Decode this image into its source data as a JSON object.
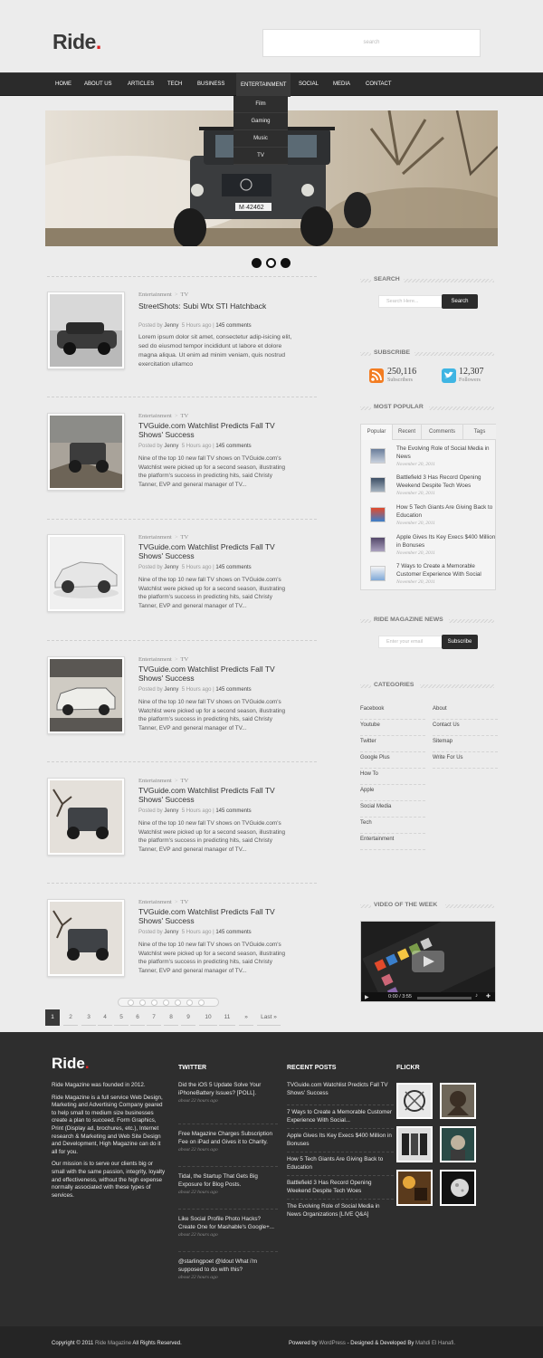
{
  "header": {
    "logo": "Ride",
    "logo_dot": ".",
    "search_placeholder": "search"
  },
  "nav": {
    "items": [
      "HOME",
      "ABOUT US",
      "ARTICLES",
      "TECH",
      "BUSINESS",
      "ENTERTAINMENT",
      "SOCIAL",
      "MEDIA",
      "CONTACT"
    ],
    "dropdown": [
      "Film",
      "Gaming",
      "Music",
      "TV"
    ]
  },
  "slider": {
    "plate": "M·42462"
  },
  "posts": [
    {
      "category": "Entertainment",
      "sub": "TV",
      "title": "StreetShots: Subi Wtx STI Hatchback",
      "posted_by": "Posted by",
      "author": "Jenny",
      "time": "5 Hours ago",
      "comments": "145 comments",
      "excerpt": "Lorem ipsum dolor sit amet, consectetur adip-isicing elit, sed do eiusmod tempor incididunt ut labore et dolore magna aliqua. Ut enim ad minim veniam, quis nostrud exercitation ullamco"
    },
    {
      "category": "Entertainment",
      "sub": "TV",
      "title": "TVGuide.com Watchlist Predicts Fall TV Shows' Success",
      "posted_by": "Posted by",
      "author": "Jenny",
      "time": "5 Hours ago",
      "comments": "145 comments",
      "excerpt": "Nine of the top 10 new fall TV shows on TVGuide.com's Watchlist were picked up for a second season, illustrating the platform's success in predicting hits, said Christy Tanner, EVP and general manager of TV..."
    },
    {
      "category": "Entertainment",
      "sub": "TV",
      "title": "TVGuide.com Watchlist Predicts Fall TV Shows' Success",
      "posted_by": "Posted by",
      "author": "Jenny",
      "time": "5 Hours ago",
      "comments": "145 comments",
      "excerpt": "Nine of the top 10 new fall TV shows on TVGuide.com's Watchlist were picked up for a second season, illustrating the platform's success in predicting hits, said Christy Tanner, EVP and general manager of TV..."
    },
    {
      "category": "Entertainment",
      "sub": "TV",
      "title": "TVGuide.com Watchlist Predicts Fall TV Shows' Success",
      "posted_by": "Posted by",
      "author": "Jenny",
      "time": "5 Hours ago",
      "comments": "145 comments",
      "excerpt": "Nine of the top 10 new fall TV shows on TVGuide.com's Watchlist were picked up for a second season, illustrating the platform's success in predicting hits, said Christy Tanner, EVP and general manager of TV..."
    },
    {
      "category": "Entertainment",
      "sub": "TV",
      "title": "TVGuide.com Watchlist Predicts Fall TV Shows' Success",
      "posted_by": "Posted by",
      "author": "Jenny",
      "time": "5 Hours ago",
      "comments": "145 comments",
      "excerpt": "Nine of the top 10 new fall TV shows on TVGuide.com's Watchlist were picked up for a second season, illustrating the platform's success in predicting hits, said Christy Tanner, EVP and general manager of TV..."
    },
    {
      "category": "Entertainment",
      "sub": "TV",
      "title": "TVGuide.com Watchlist Predicts Fall TV Shows' Success",
      "posted_by": "Posted by",
      "author": "Jenny",
      "time": "5 Hours ago",
      "comments": "145 comments",
      "excerpt": "Nine of the top 10 new fall TV shows on TVGuide.com's Watchlist were picked up for a second season, illustrating the platform's success in predicting hits, said Christy Tanner, EVP and general manager of TV..."
    }
  ],
  "pagination": {
    "pages": [
      "1",
      "2",
      "3",
      "4",
      "5",
      "6",
      "7",
      "8",
      "9",
      "10",
      "11",
      "»",
      "Last »"
    ],
    "current": "1"
  },
  "sidebar": {
    "search": {
      "title": "SEARCH",
      "placeholder": "Search Here...",
      "button": "Search"
    },
    "subscribe": {
      "title": "SUBSCRIBE",
      "rss_count": "250,116",
      "rss_label": "Subscribers",
      "twitter_count": "12,307",
      "twitter_label": "Followers"
    },
    "popular": {
      "title": "MOST POPULAR",
      "tabs": [
        "Popular",
        "Recent",
        "Comments",
        "Tags"
      ],
      "items": [
        {
          "title": "The Evolving Role of Social Media in News",
          "date": "November 20, 2011"
        },
        {
          "title": "Battlefield 3 Has Record Opening Weekend Despite Tech Woes",
          "date": "November 20, 2011"
        },
        {
          "title": "How 5 Tech Giants Are Giving Back to Education",
          "date": "November 20, 2011"
        },
        {
          "title": "Apple Gives Its Key Execs $400 Million in Bonuses",
          "date": "November 20, 2011"
        },
        {
          "title": "7 Ways to Create a Memorable Customer Experience With Social",
          "date": "November 20, 2011"
        }
      ]
    },
    "news": {
      "title": "RIDE MAGAZINE NEWS",
      "placeholder": "Enter your email",
      "button": "Subscribe"
    },
    "categories": {
      "title": "CATEGORIES",
      "left": [
        "Facebook",
        "Youtube",
        "Twitter",
        "Google Plus",
        "How To",
        "Apple",
        "Social Media",
        "Tech",
        "Entertainment"
      ],
      "right": [
        "About",
        "Contact Us",
        "Sitemap",
        "Write For Us"
      ]
    },
    "video": {
      "title": "VIDEO OF THE WEEK",
      "time": "0:00 / 3:55"
    }
  },
  "footer": {
    "logo": "Ride",
    "about": [
      "Ride Magazine was founded in 2012.",
      "Ride Magazine is a full service Web Design, Marketing and Advertising Company geared to help small to medium size businesses create a plan to succeed. Form Graphics, Print (Display ad, brochures, etc.), Internet research & Marketing and Web Site Design and Development, High Magazine can do it all for you.",
      "Our mission is to serve our clients big or small with the same passion, integrity, loyalty and effectiveness, without the high expense normally associated with these types of services."
    ],
    "twitter": {
      "title": "TWITTER",
      "tweets": [
        {
          "text": "Did the iOS 5 Update Solve Your iPhoneBattery Issues? [POLL].",
          "date": "about 22 hours ago"
        },
        {
          "text": "Free Magazine Charges Subscription Fee on iPad and Gives it to Charity.",
          "date": "about 22 hours ago"
        },
        {
          "text": "Tidal, the Startup That Gets Big Exposure for Blog Posts.",
          "date": "about 22 hours ago"
        },
        {
          "text": "Like Social Profile Photo Hacks? Create One for Mashable's Google+...",
          "date": "about 22 hours ago"
        },
        {
          "text": "@starlingpoet @Idout What i'm supposed to do with this?",
          "date": "about 22 hours ago"
        }
      ]
    },
    "recent": {
      "title": "RECENT POSTS",
      "items": [
        "TVGuide.com Watchlist Predicts Fall TV Shows' Success",
        "7 Ways to Create a Memorable Customer Experience With Social...",
        "Apple Gives Its Key Execs $400 Million in Bonuses",
        "How 5 Tech Giants Are Giving Back to Education",
        "Battlefield 3 Has Record Opening Weekend Despite Tech Woes",
        "The Evolving Role of Social Media in News Organizations [LIVE Q&A]"
      ]
    },
    "flickr": {
      "title": "FLICKR"
    },
    "copyright_pre": "Copyright © 2011",
    "copyright_link": "Ride Magazine",
    "copyright_post": "All Rights Reserved.",
    "credits_pre": "Powered by",
    "credits_wp": "WordPress",
    "credits_mid": "- Designed & Developed By",
    "credits_author": "Mahdi El Hanafi."
  },
  "colors": {
    "accent": "#dd2222",
    "dark": "#2b2b2b",
    "footer": "#2e2e2e",
    "rss": "#f37d22",
    "twitter": "#3fb5e3"
  }
}
